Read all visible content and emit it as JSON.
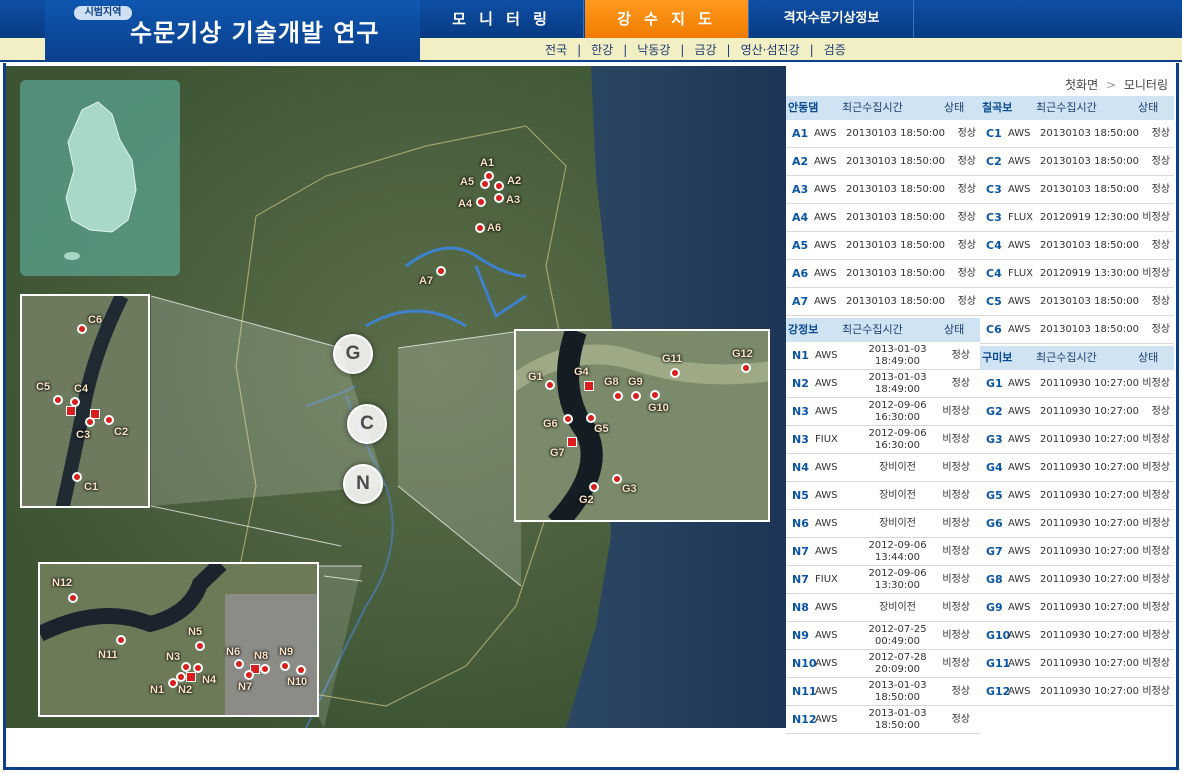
{
  "header": {
    "badge": "시범지역",
    "title": "수문기상 기술개발 연구",
    "nav": [
      "모 니 터 링",
      "강 수 지 도",
      "격자수문기상정보"
    ],
    "subnav": [
      "전국",
      "|",
      "한강",
      "|",
      "낙동강",
      "|",
      "금강",
      "|",
      "영산·섬진강",
      "|",
      "검증"
    ]
  },
  "breadcrumb": {
    "home": "첫화면",
    "sep": ">",
    "current": "모니터링"
  },
  "colors": {
    "accent": "#f08000",
    "brand": "#0b3f88",
    "pin": "#d91e1e"
  },
  "map": {
    "circles": [
      "G",
      "C",
      "N"
    ],
    "pins": [
      "A1",
      "A2",
      "A3",
      "A4",
      "A5",
      "A6",
      "A7"
    ],
    "c_labels": [
      "C6",
      "C5",
      "C4",
      "C3",
      "C2",
      "C1"
    ],
    "g_labels": [
      "G1",
      "G4",
      "G8",
      "G9",
      "G11",
      "G12",
      "G6",
      "G5",
      "G10",
      "G7",
      "G2",
      "G3"
    ],
    "n_labels": [
      "N12",
      "N5",
      "N11",
      "N3",
      "N6",
      "N8",
      "N9",
      "N2",
      "N4",
      "N1",
      "N7",
      "N10"
    ]
  },
  "andong": {
    "title": "안동댐",
    "col_time": "최근수집시간",
    "col_state": "상태",
    "rows": [
      {
        "id": "A1",
        "type": "AWS",
        "time": "20130103 18:50:00",
        "state": "정상"
      },
      {
        "id": "A2",
        "type": "AWS",
        "time": "20130103 18:50:00",
        "state": "정상"
      },
      {
        "id": "A3",
        "type": "AWS",
        "time": "20130103 18:50:00",
        "state": "정상"
      },
      {
        "id": "A4",
        "type": "AWS",
        "time": "20130103 18:50:00",
        "state": "정상"
      },
      {
        "id": "A5",
        "type": "AWS",
        "time": "20130103 18:50:00",
        "state": "정상"
      },
      {
        "id": "A6",
        "type": "AWS",
        "time": "20130103 18:50:00",
        "state": "정상"
      },
      {
        "id": "A7",
        "type": "AWS",
        "time": "20130103 18:50:00",
        "state": "정상"
      }
    ]
  },
  "chilgok": {
    "title": "칠곡보",
    "col_time": "최근수집시간",
    "col_state": "상태",
    "rows": [
      {
        "id": "C1",
        "type": "AWS",
        "time": "20130103 18:50:00",
        "state": "정상"
      },
      {
        "id": "C2",
        "type": "AWS",
        "time": "20130103 18:50:00",
        "state": "정상"
      },
      {
        "id": "C3",
        "type": "AWS",
        "time": "20130103 18:50:00",
        "state": "정상"
      },
      {
        "id": "C3",
        "type": "FLUX",
        "time": "20120919 12:30:00",
        "state": "비정상"
      },
      {
        "id": "C4",
        "type": "AWS",
        "time": "20130103 18:50:00",
        "state": "정상"
      },
      {
        "id": "C4",
        "type": "FLUX",
        "time": "20120919 13:30:00",
        "state": "비정상"
      },
      {
        "id": "C5",
        "type": "AWS",
        "time": "20130103 18:50:00",
        "state": "정상"
      },
      {
        "id": "C6",
        "type": "AWS",
        "time": "20130103 18:50:00",
        "state": "정상"
      }
    ]
  },
  "gangjeong": {
    "title": "강정보",
    "col_time": "최근수집시간",
    "col_state": "상태",
    "rows": [
      {
        "id": "N1",
        "type": "AWS",
        "d": "2013-01-03",
        "t": "18:49:00",
        "state": "정상"
      },
      {
        "id": "N2",
        "type": "AWS",
        "d": "2013-01-03",
        "t": "18:49:00",
        "state": "정상"
      },
      {
        "id": "N3",
        "type": "AWS",
        "d": "2012-09-06",
        "t": "16:30:00",
        "state": "비정상"
      },
      {
        "id": "N3",
        "type": "FIUX",
        "d": "2012-09-06",
        "t": "16:30:00",
        "state": "비정상"
      },
      {
        "id": "N4",
        "type": "AWS",
        "d": "장비이전",
        "t": "",
        "state": "비정상"
      },
      {
        "id": "N5",
        "type": "AWS",
        "d": "장비이전",
        "t": "",
        "state": "비정상"
      },
      {
        "id": "N6",
        "type": "AWS",
        "d": "장비이전",
        "t": "",
        "state": "비정상"
      },
      {
        "id": "N7",
        "type": "AWS",
        "d": "2012-09-06",
        "t": "13:44:00",
        "state": "비정상"
      },
      {
        "id": "N7",
        "type": "FIUX",
        "d": "2012-09-06",
        "t": "13:30:00",
        "state": "비정상"
      },
      {
        "id": "N8",
        "type": "AWS",
        "d": "장비이전",
        "t": "",
        "state": "비정상"
      },
      {
        "id": "N9",
        "type": "AWS",
        "d": "2012-07-25",
        "t": "00:49:00",
        "state": "비정상"
      },
      {
        "id": "N10",
        "type": "AWS",
        "d": "2012-07-28",
        "t": "20:09:00",
        "state": "비정상"
      },
      {
        "id": "N11",
        "type": "AWS",
        "d": "2013-01-03",
        "t": "18:50:00",
        "state": "정상"
      },
      {
        "id": "N12",
        "type": "AWS",
        "d": "2013-01-03",
        "t": "18:50:00",
        "state": "정상"
      }
    ]
  },
  "gumi": {
    "title": "구미보",
    "col_time": "최근수집시간",
    "col_state": "상태",
    "rows": [
      {
        "id": "G1",
        "type": "AWS",
        "time": "20110930 10:27:00",
        "state": "비정상"
      },
      {
        "id": "G2",
        "type": "AWS",
        "time": "20110930 10:27:00",
        "state": "정상"
      },
      {
        "id": "G3",
        "type": "AWS",
        "time": "20110930 10:27:00",
        "state": "비정상"
      },
      {
        "id": "G4",
        "type": "AWS",
        "time": "20110930 10:27:00",
        "state": "비정상"
      },
      {
        "id": "G5",
        "type": "AWS",
        "time": "20110930 10:27:00",
        "state": "비정상"
      },
      {
        "id": "G6",
        "type": "AWS",
        "time": "20110930 10:27:00",
        "state": "비정상"
      },
      {
        "id": "G7",
        "type": "AWS",
        "time": "20110930 10:27:00",
        "state": "비정상"
      },
      {
        "id": "G8",
        "type": "AWS",
        "time": "20110930 10:27:00",
        "state": "비정상"
      },
      {
        "id": "G9",
        "type": "AWS",
        "time": "20110930 10:27:00",
        "state": "비정상"
      },
      {
        "id": "G10",
        "type": "AWS",
        "time": "20110930 10:27:00",
        "state": "비정상"
      },
      {
        "id": "G11",
        "type": "AWS",
        "time": "20110930 10:27:00",
        "state": "비정상"
      },
      {
        "id": "G12",
        "type": "AWS",
        "time": "20110930 10:27:00",
        "state": "비정상"
      }
    ]
  }
}
